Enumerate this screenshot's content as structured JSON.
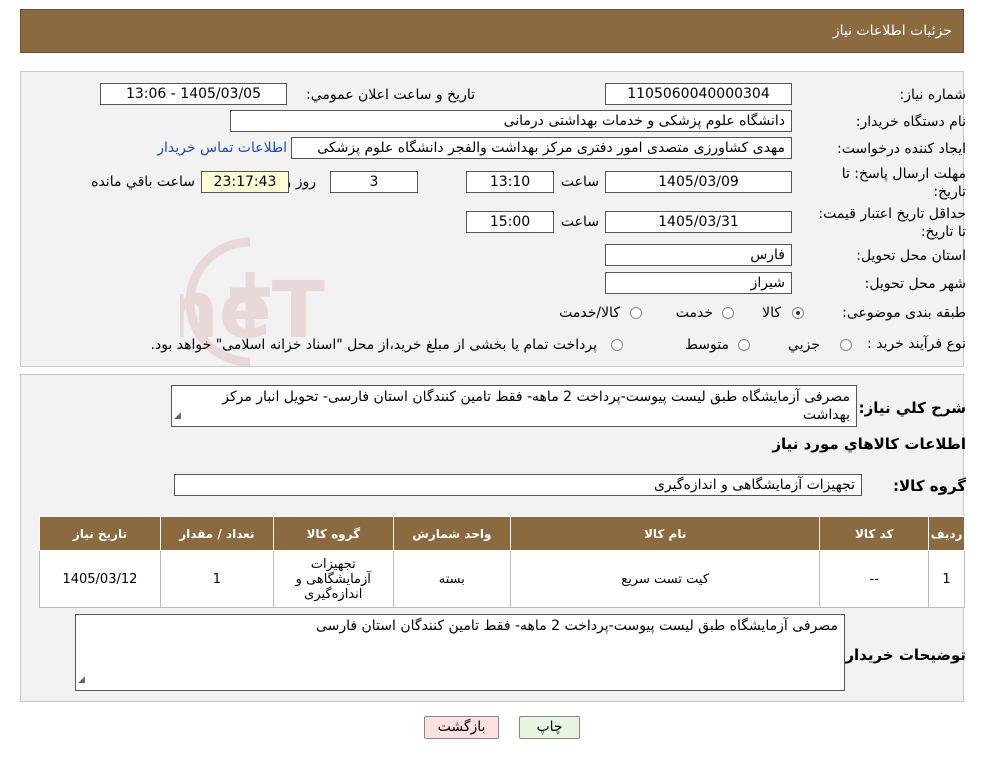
{
  "header": {
    "title": "جزئیات اطلاعات نیاز"
  },
  "form": {
    "need_number_label": "شماره نیاز:",
    "need_number": "1105060040000304",
    "announce_label": "تاریخ و ساعت اعلان عمومي:",
    "announce_value": "1405/03/05 - 13:06",
    "buyer_org_label": "نام دستگاه خریدار:",
    "buyer_org": "دانشگاه علوم پزشکی و خدمات بهداشتی درمانی",
    "creator_label": "ایجاد کننده درخواست:",
    "creator": "مهدی کشاورزی متصدی امور دفتری مرکز بهداشت والفجر دانشگاه علوم پزشکی",
    "contact_link": "اطلاعات تماس خریدار",
    "deadline_label": "مهلت ارسال پاسخ: تا تاریخ:",
    "deadline_date": "1405/03/09",
    "time_label": "ساعت",
    "deadline_time": "13:10",
    "days_value": "3",
    "days_label": "روز و",
    "remaining_time": "23:17:43",
    "remaining_label": "ساعت باقي مانده",
    "validity_label": "حداقل تاریخ اعتبار قیمت: تا تاریخ:",
    "validity_date": "1405/03/31",
    "validity_time": "15:00",
    "province_label": "استان محل تحویل:",
    "province": "فارس",
    "city_label": "شهر محل تحویل:",
    "city": "شیراز",
    "category_label": "طبقه بندی موضوعی:",
    "category_options": [
      "کالا",
      "خدمت",
      "کالا/خدمت"
    ],
    "purchase_type_label": "نوع فرآیند خرید :",
    "purchase_options": [
      "جزیي",
      "متوسط"
    ],
    "purchase_note": "پرداخت تمام یا بخشی از مبلغ خرید،از محل \"اسناد خزانه اسلامی\" خواهد بود."
  },
  "summary": {
    "description_label": "شرح کلي نیاز:",
    "description": "مصرفی آزمایشگاه طبق لیست پیوست-پرداخت 2 ماهه- فقط تامین کنندگان استان فارسی- تحویل انبار مرکز بهداشت",
    "items_heading": "اطلاعات کالاهاي مورد نیاز",
    "group_label": "گروه کالا:",
    "group_value": "تجهیزات آزمایشگاهی و اندازه‌گیری"
  },
  "table": {
    "headers": [
      "ردیف",
      "کد کالا",
      "نام کالا",
      "واحد شمارش",
      "گروه کالا",
      "تعداد / مقدار",
      "تاریخ نیاز"
    ],
    "rows": [
      [
        "1",
        "--",
        "کیت تست سریع",
        "بسته",
        "تجهیزات آزمایشگاهی و اندازه‌گیری",
        "1",
        "1405/03/12"
      ]
    ]
  },
  "buyer_notes": {
    "label": "توضیحات خریدار:",
    "text": "مصرفی آزمایشگاه طبق لیست پیوست-پرداخت 2 ماهه- فقط تامین کنندگان استان فارسی"
  },
  "buttons": {
    "print": "چاپ",
    "back": "بازگشت"
  },
  "colors": {
    "header": "#8b6a3f",
    "back_button": "#fde0e0",
    "print_button": "#e8f5e0"
  }
}
